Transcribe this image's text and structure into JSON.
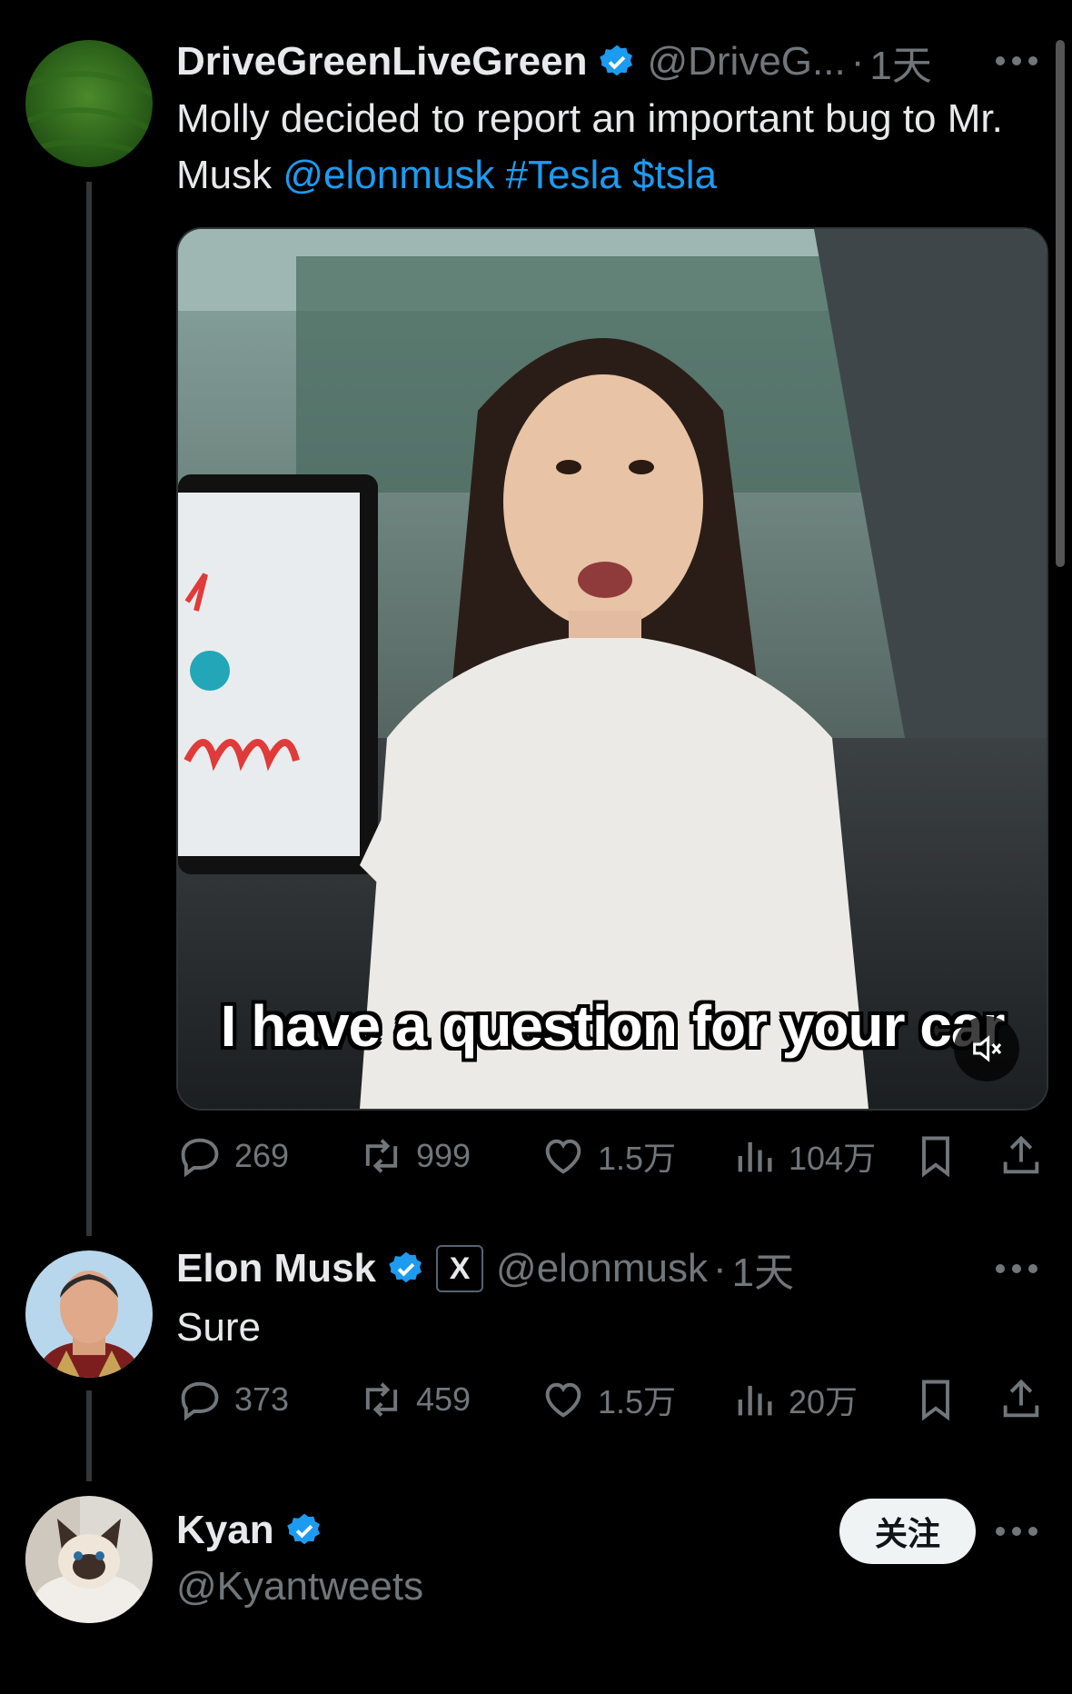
{
  "tweets": [
    {
      "name": "DriveGreenLiveGreen",
      "handle": "@DriveG...",
      "sep": "·",
      "time": "1天",
      "text_plain": "Molly decided to report an important bug to Mr. Musk ",
      "mentions": [
        "@elonmusk",
        "#Tesla",
        "$tsla"
      ],
      "media_caption": "I have a question for your car",
      "stats": {
        "replies": "269",
        "retweets": "999",
        "likes": "1.5万",
        "views": "104万"
      }
    },
    {
      "name": "Elon Musk",
      "handle": "@elonmusk",
      "sep": "·",
      "time": "1天",
      "text": "Sure",
      "badge": "X",
      "stats": {
        "replies": "373",
        "retweets": "459",
        "likes": "1.5万",
        "views": "20万"
      }
    },
    {
      "name": "Kyan",
      "handle": "@Kyantweets",
      "follow_label": "关注"
    }
  ],
  "colors": {
    "accent": "#1d9bf0",
    "muted": "#71767b",
    "background": "#000000"
  },
  "icons": [
    "verified-icon",
    "more-icon",
    "reply-icon",
    "retweet-icon",
    "like-icon",
    "views-icon",
    "bookmark-icon",
    "share-icon",
    "mute-icon"
  ]
}
